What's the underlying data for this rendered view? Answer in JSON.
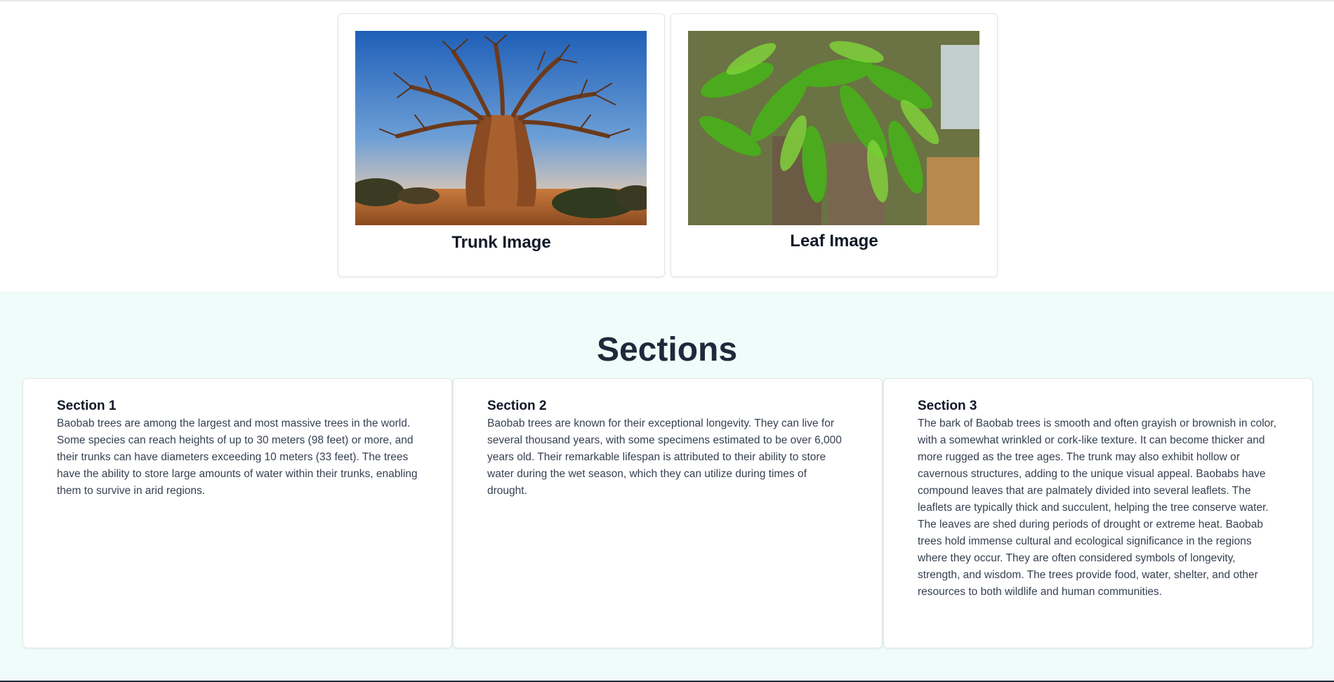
{
  "images": {
    "trunk_caption": "Trunk Image",
    "leaf_caption": "Leaf Image"
  },
  "sections": {
    "heading": "Sections",
    "items": [
      {
        "title": "Section 1",
        "body": "Baobab trees are among the largest and most massive trees in the world. Some species can reach heights of up to 30 meters (98 feet) or more, and their trunks can have diameters exceeding 10 meters (33 feet). The trees have the ability to store large amounts of water within their trunks, enabling them to survive in arid regions."
      },
      {
        "title": "Section 2",
        "body": "Baobab trees are known for their exceptional longevity. They can live for several thousand years, with some specimens estimated to be over 6,000 years old. Their remarkable lifespan is attributed to their ability to store water during the wet season, which they can utilize during times of drought."
      },
      {
        "title": "Section 3",
        "body": "The bark of Baobab trees is smooth and often grayish or brownish in color, with a somewhat wrinkled or cork-like texture. It can become thicker and more rugged as the tree ages. The trunk may also exhibit hollow or cavernous structures, adding to the unique visual appeal. Baobabs have compound leaves that are palmately divided into several leaflets. The leaflets are typically thick and succulent, helping the tree conserve water. The leaves are shed during periods of drought or extreme heat. Baobab trees hold immense cultural and ecological significance in the regions where they occur. They are often considered symbols of longevity, strength, and wisdom. The trees provide food, water, shelter, and other resources to both wildlife and human communities."
      }
    ]
  }
}
